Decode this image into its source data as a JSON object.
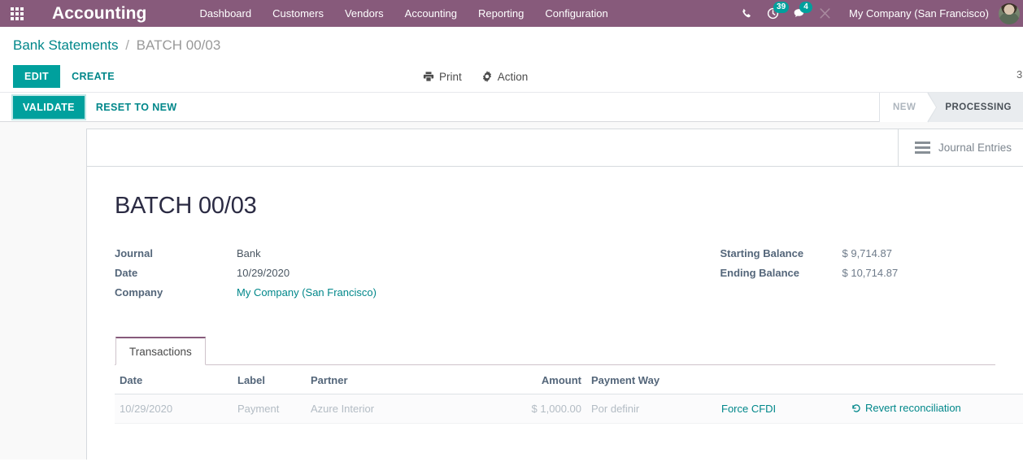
{
  "navbar": {
    "apps_icon": "apps-grid-icon",
    "brand": "Accounting",
    "menu": [
      {
        "label": "Dashboard"
      },
      {
        "label": "Customers"
      },
      {
        "label": "Vendors"
      },
      {
        "label": "Accounting"
      },
      {
        "label": "Reporting"
      },
      {
        "label": "Configuration"
      }
    ],
    "systray": {
      "phone_icon": "phone-icon",
      "activity_icon": "clock-activity-icon",
      "activity_count": "39",
      "messages_icon": "chat-bubble-icon",
      "messages_count": "4",
      "tools_icon": "wrench-tools-icon",
      "company": "My Company (San Francisco)",
      "avatar_icon": "user-avatar"
    },
    "accent_color": "#875a7b",
    "badge_color": "#00a09d"
  },
  "control_panel": {
    "breadcrumb": {
      "root": "Bank Statements",
      "separator": "/",
      "current": "BATCH 00/03"
    },
    "edit_label": "EDIT",
    "create_label": "CREATE",
    "print_label": "Print",
    "print_icon": "printer-icon",
    "action_label": "Action",
    "action_icon": "gear-icon",
    "pager": "3"
  },
  "statusbar": {
    "validate_label": "VALIDATE",
    "reset_label": "RESET TO NEW",
    "stages": [
      {
        "label": "NEW",
        "active": false
      },
      {
        "label": "PROCESSING",
        "active": true
      }
    ],
    "primary_color": "#00a09d"
  },
  "sheet": {
    "stat_button": {
      "icon": "journal-lines-icon",
      "label": "Journal Entries"
    },
    "title": "BATCH 00/03",
    "fields_left": [
      {
        "label": "Journal",
        "value": "Bank",
        "link": false
      },
      {
        "label": "Date",
        "value": "10/29/2020",
        "link": false
      },
      {
        "label": "Company",
        "value": "My Company (San Francisco)",
        "link": true
      }
    ],
    "fields_right": [
      {
        "label": "Starting Balance",
        "value": "$ 9,714.87"
      },
      {
        "label": "Ending Balance",
        "value": "$ 10,714.87"
      }
    ],
    "notebook": {
      "tabs": [
        {
          "label": "Transactions",
          "active": true
        }
      ],
      "table": {
        "columns": [
          "Date",
          "Label",
          "Partner",
          "Amount",
          "Payment Way",
          "",
          ""
        ],
        "optional_columns_icon": "vertical-dots-icon",
        "rows": [
          {
            "date": "10/29/2020",
            "label": "Payment",
            "partner": "Azure Interior",
            "amount": "$ 1,000.00",
            "payment_way": "Por definir",
            "force_cfdi": "Force CFDI",
            "revert_icon": "revert-arrow-icon",
            "revert": "Revert reconciliation"
          }
        ]
      }
    }
  }
}
